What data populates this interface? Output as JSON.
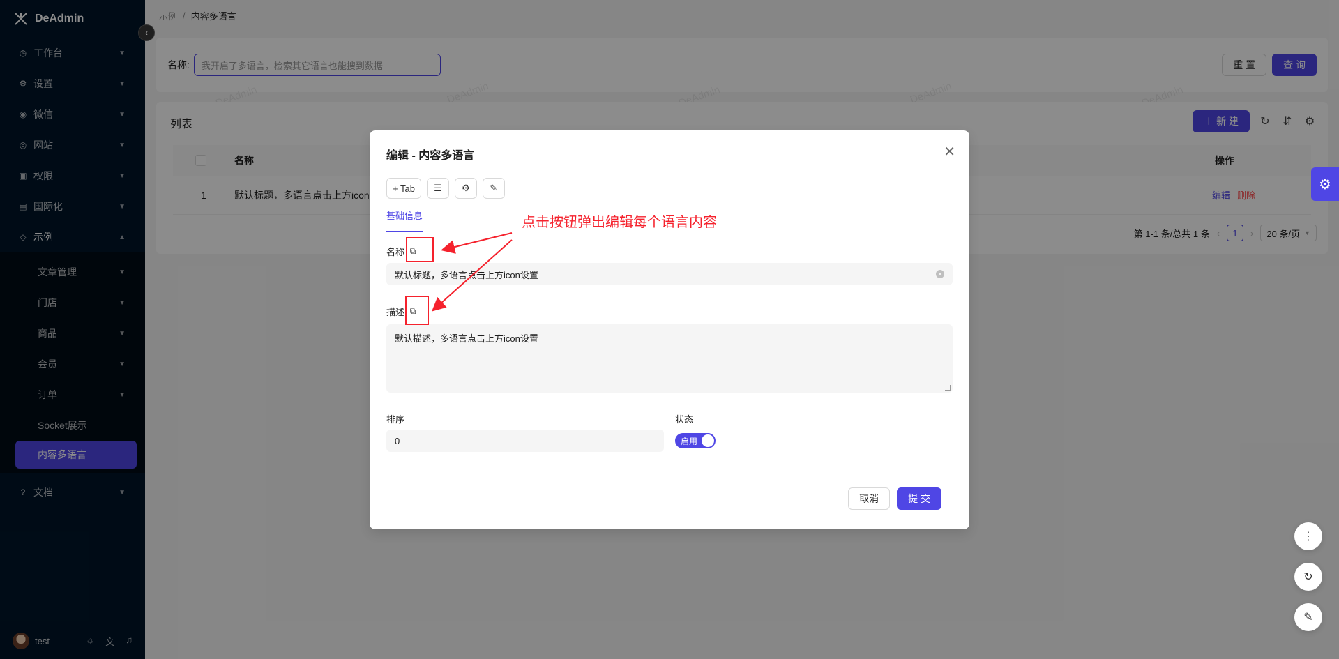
{
  "app": {
    "name": "DeAdmin"
  },
  "sidebar": {
    "items": [
      {
        "label": "工作台",
        "icon": "dashboard-icon"
      },
      {
        "label": "设置",
        "icon": "gear-icon"
      },
      {
        "label": "微信",
        "icon": "wechat-icon"
      },
      {
        "label": "网站",
        "icon": "globe-icon"
      },
      {
        "label": "权限",
        "icon": "lock-icon"
      },
      {
        "label": "国际化",
        "icon": "translate-icon"
      },
      {
        "label": "示例",
        "icon": "tag-icon"
      }
    ],
    "sub_items": [
      {
        "label": "文章管理"
      },
      {
        "label": "门店"
      },
      {
        "label": "商品"
      },
      {
        "label": "会员"
      },
      {
        "label": "订单"
      },
      {
        "label": "Socket展示"
      },
      {
        "label": "内容多语言"
      }
    ],
    "docs": {
      "label": "文档",
      "icon": "question-icon"
    },
    "user": {
      "name": "test"
    }
  },
  "breadcrumb": {
    "parent": "示例",
    "sep": "/",
    "current": "内容多语言"
  },
  "search": {
    "label": "名称:",
    "placeholder": "我开启了多语言，检索其它语言也能搜到数据",
    "reset_label": "重 置",
    "query_label": "查 询"
  },
  "list": {
    "title": "列表",
    "new_label": "新 建",
    "columns": {
      "name": "名称",
      "ops": "操作"
    },
    "rows": [
      {
        "index": "1",
        "name": "默认标题，多语言点击上方icon",
        "edit": "编辑",
        "delete": "删除"
      }
    ],
    "pagination": {
      "summary": "第 1-1 条/总共 1 条",
      "current": "1",
      "page_size": "20 条/页"
    }
  },
  "watermark": "DeAdmin",
  "modal": {
    "title": "编辑 - 内容多语言",
    "toolbar": {
      "add_tab": "+ Tab"
    },
    "tab": "基础信息",
    "fields": {
      "name": {
        "label": "名称",
        "value": "默认标题，多语言点击上方icon设置"
      },
      "desc": {
        "label": "描述",
        "value": "默认描述，多语言点击上方icon设置"
      },
      "sort": {
        "label": "排序",
        "value": "0"
      },
      "status": {
        "label": "状态",
        "value": "启用"
      }
    },
    "cancel_label": "取消",
    "submit_label": "提 交"
  },
  "annotation": {
    "text": "点击按钮弹出编辑每个语言内容"
  },
  "colors": {
    "primary": "#4f46e5",
    "sidebar": "#001529",
    "annotation": "#f5222d"
  }
}
